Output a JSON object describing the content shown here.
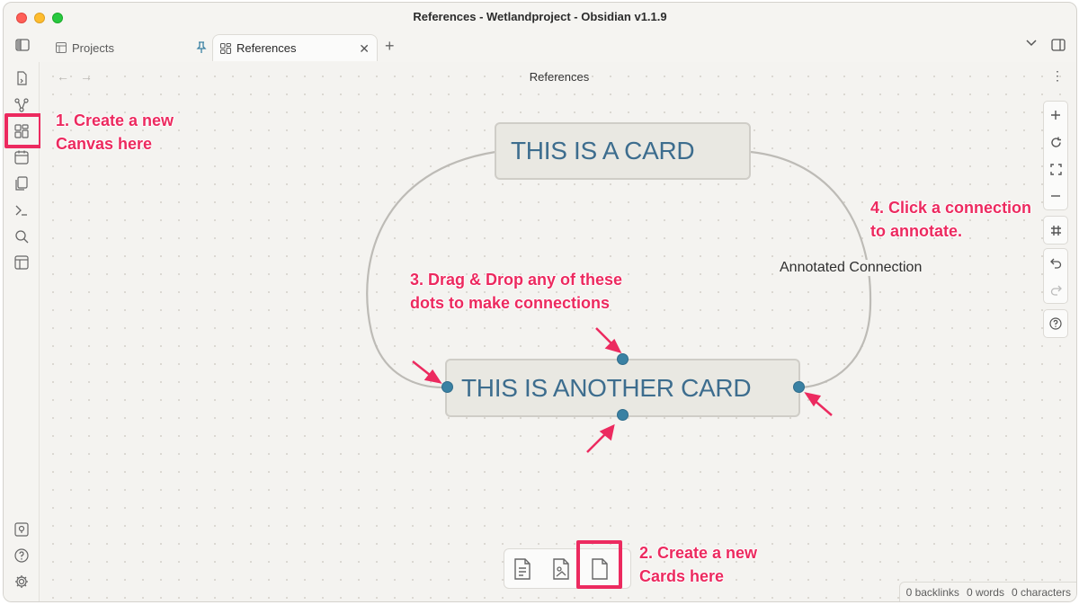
{
  "window": {
    "title": "References - Wetlandproject - Obsidian v1.1.9"
  },
  "tabs": [
    {
      "label": "Projects",
      "active": false
    },
    {
      "label": "References",
      "active": true
    }
  ],
  "view": {
    "title": "References"
  },
  "canvas": {
    "cards": [
      {
        "text": "THIS IS A CARD"
      },
      {
        "text": "THIS IS ANOTHER CARD"
      }
    ],
    "connection_label": "Annotated Connection"
  },
  "annotations": {
    "step1_line1": "1. Create a new",
    "step1_line2": "Canvas here",
    "step2_line1": "2. Create a new",
    "step2_line2": "Cards here",
    "step3_line1": "3. Drag & Drop any of these",
    "step3_line2": "dots to make connections",
    "step4_line1": "4. Click a connection",
    "step4_line2": "to annotate."
  },
  "status": {
    "backlinks": "0 backlinks",
    "words": "0 words",
    "characters": "0 characters"
  },
  "colors": {
    "accent": "#ec2a5f",
    "card_text": "#3d6d8e",
    "connection_dot": "#3a81a3"
  }
}
